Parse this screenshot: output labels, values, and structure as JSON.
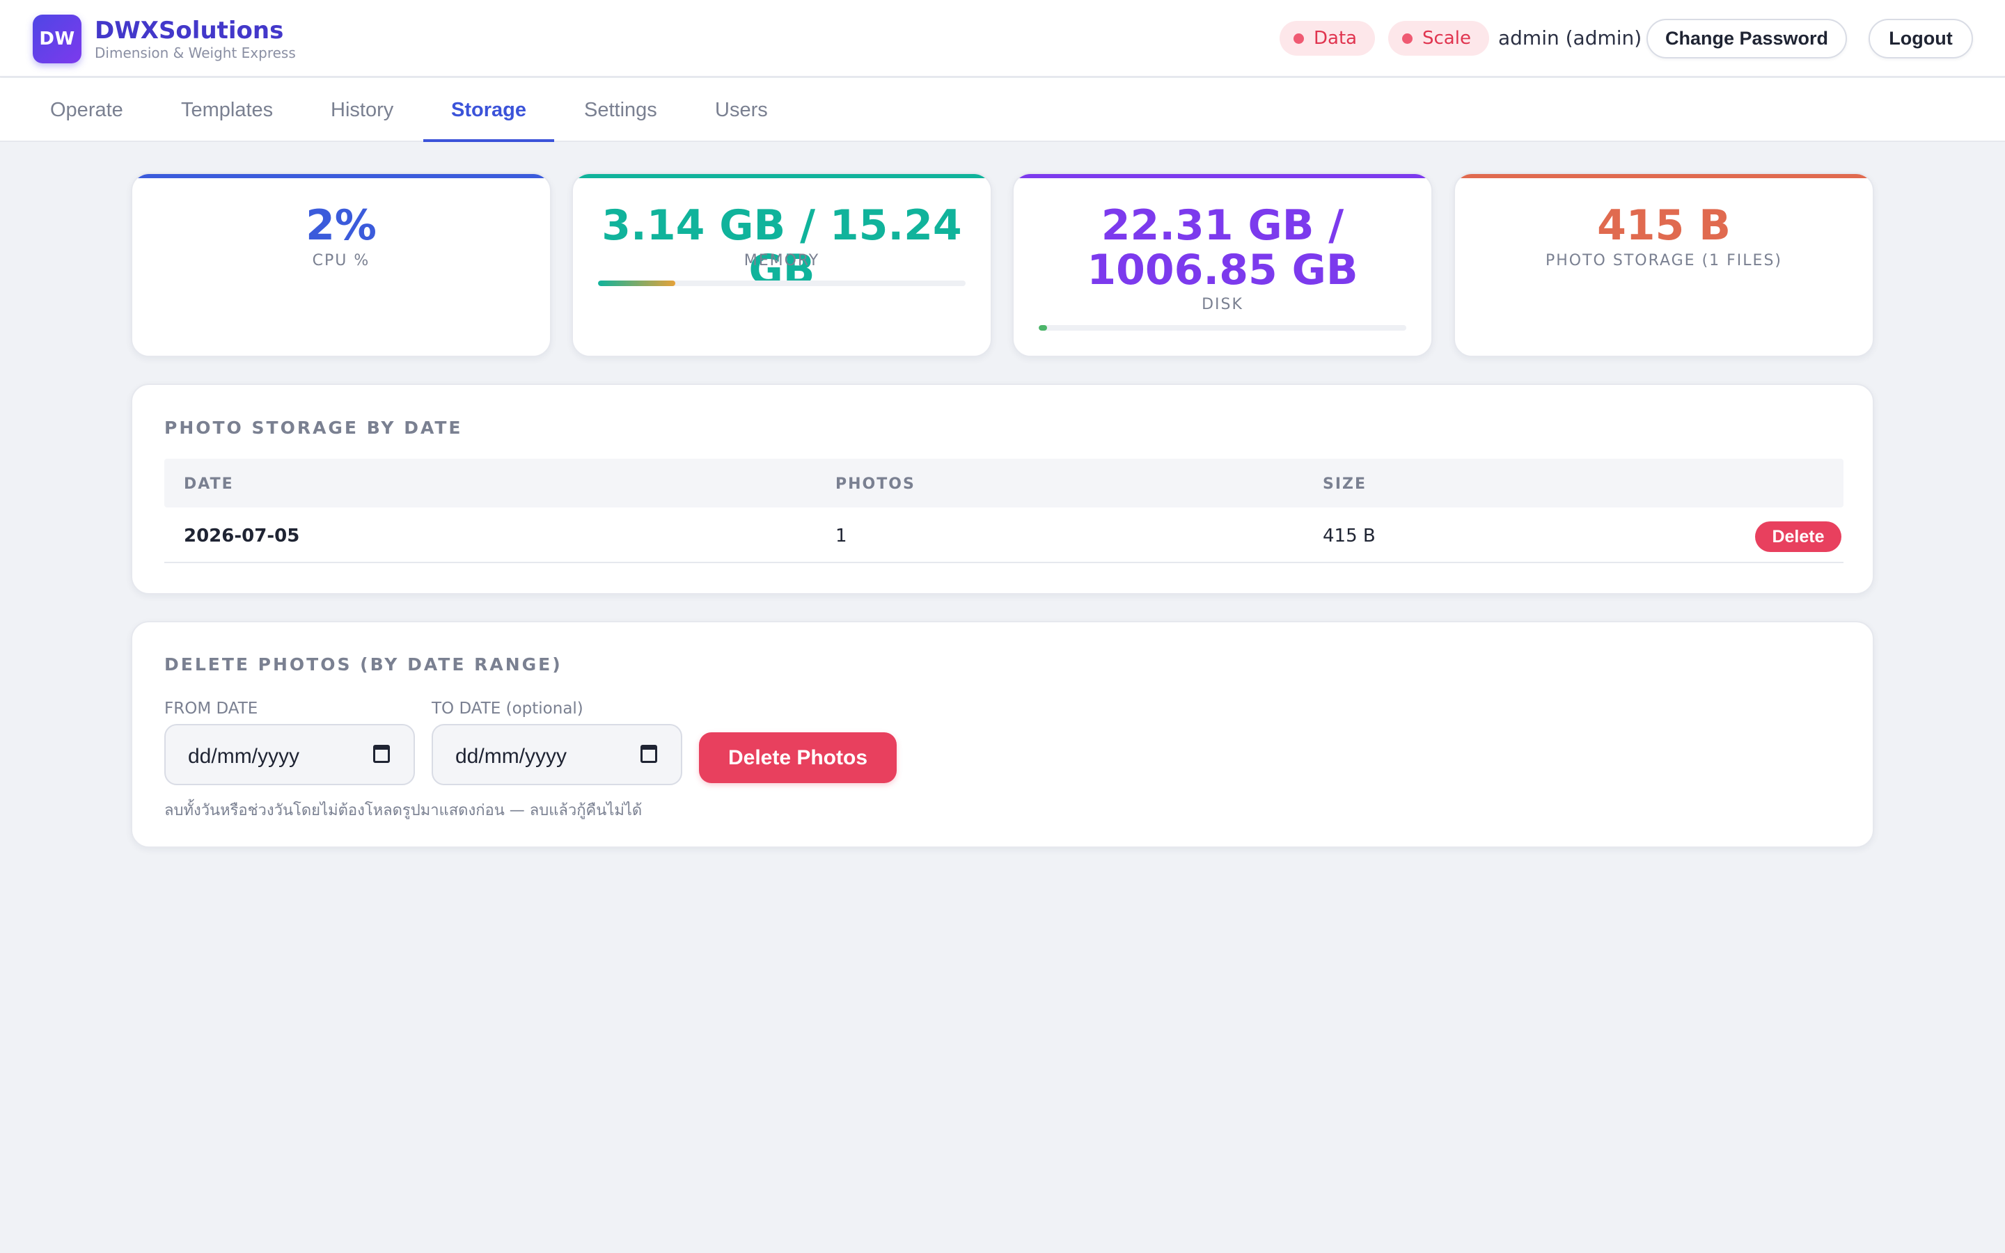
{
  "app": {
    "logo_initials": "DW",
    "brand_name": "DWXSolutions",
    "brand_subtitle": "Dimension & Weight Express"
  },
  "header": {
    "status_pills": [
      {
        "label": "Data",
        "color": "#e0344f"
      },
      {
        "label": "Scale",
        "color": "#e0344f"
      }
    ],
    "user_label": "admin (admin)",
    "change_password_label": "Change Password",
    "logout_label": "Logout"
  },
  "tabs": [
    {
      "label": "Operate",
      "active": false
    },
    {
      "label": "Templates",
      "active": false
    },
    {
      "label": "History",
      "active": false
    },
    {
      "label": "Storage",
      "active": true
    },
    {
      "label": "Settings",
      "active": false
    },
    {
      "label": "Users",
      "active": false
    }
  ],
  "stats": {
    "cpu": {
      "value": "2%",
      "label": "CPU %",
      "color": "#3b5bdb"
    },
    "memory": {
      "value": "3.14 GB / 15.24 GB",
      "label": "MEMORY",
      "usage_fraction": 0.21,
      "color": "#10b39b"
    },
    "disk": {
      "value": "22.31 GB / 1006.85 GB",
      "label": "DISK",
      "usage_fraction": 0.022,
      "color": "#7c3aed"
    },
    "photo_storage": {
      "value": "415 B",
      "label": "PHOTO STORAGE (1 FILES)",
      "color": "#e06a4f"
    }
  },
  "photo_storage_by_date": {
    "title": "PHOTO STORAGE BY DATE",
    "columns": [
      "DATE",
      "PHOTOS",
      "SIZE"
    ],
    "rows": [
      {
        "date": "2026-07-05",
        "photos": "1",
        "size": "415 B",
        "action_label": "Delete"
      }
    ]
  },
  "delete_photos": {
    "title": "DELETE PHOTOS (BY DATE RANGE)",
    "from_label": "FROM DATE",
    "to_label": "TO DATE (optional)",
    "from_placeholder": "dd/mm/yyyy",
    "to_placeholder": "dd/mm/yyyy",
    "button_label": "Delete Photos",
    "hint": "ลบทั้งวันหรือช่วงวันโดยไม่ต้องโหลดรูปมาแสดงก่อน — ลบแล้วกู้คืนไม่ได้"
  },
  "colors": {
    "accent": "#3b53d9",
    "danger": "#e8405e",
    "background": "#f0f2f6"
  }
}
